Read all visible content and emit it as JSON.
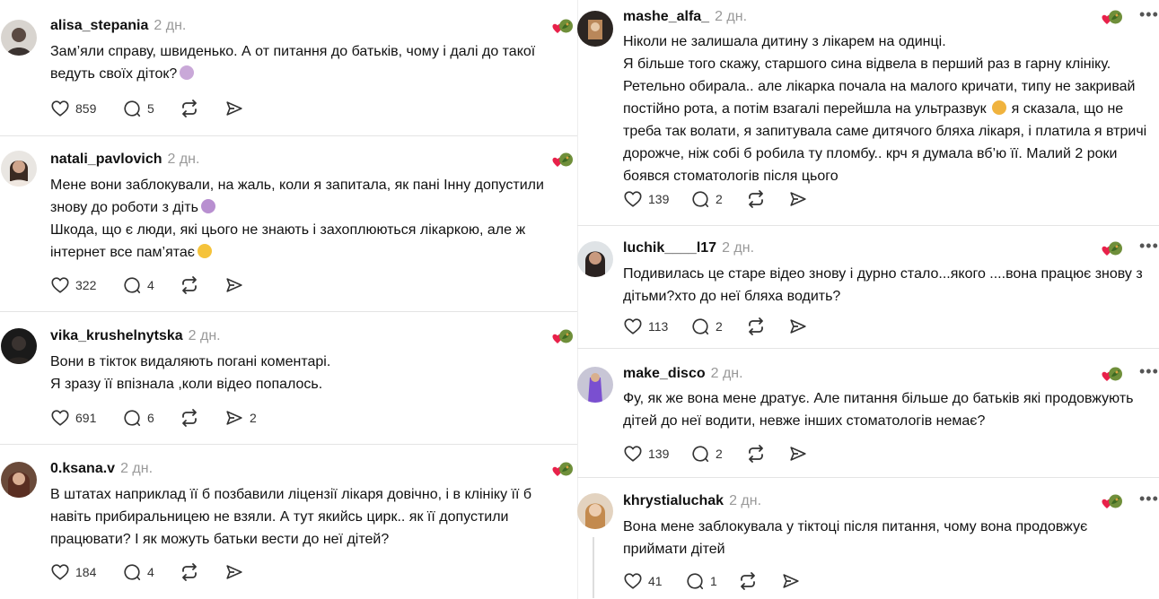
{
  "colors": {
    "separator": "#e4e4e4",
    "username": "#111111",
    "time": "#999999",
    "icon": "#333333",
    "badge_heart": "#e8214a",
    "badge_leaf": "#4a7a2a"
  },
  "left_column": {
    "posts": [
      {
        "username": "alisa_stepania",
        "time": "2 дн.",
        "lines": [
          "Зам’яли справу, швиденько. А от питання до батьків, чому і далі до такої",
          "ведуть своїх діток?"
        ],
        "emoji_icon": "woman-shrugging-emoji",
        "likes": "859",
        "replies": "5",
        "reposts": "",
        "shares": ""
      },
      {
        "username": "natali_pavlovich",
        "time": "2 дн.",
        "lines": [
          "Мене вони заблокували, на жаль, коли я запитала, як пані Інну допустили",
          "знову до роботи з діть",
          "Шкода, що є люди, які цього не знають і захоплюються лікаркою, але ж",
          "інтернет все пам’ятає"
        ],
        "emoji_icon": "face-emoji",
        "likes": "322",
        "replies": "4",
        "reposts": "",
        "shares": ""
      },
      {
        "username": "vika_krushelnytska",
        "time": "2 дн.",
        "lines": [
          "Вони в тікток видаляють погані коментарі.",
          "Я зразу її впізнала ,коли відео попалось."
        ],
        "likes": "691",
        "replies": "6",
        "reposts": "",
        "shares": "2"
      },
      {
        "username": "0.ksana.v",
        "time": "2 дн.",
        "lines": [
          "В штатах наприклад її б позбавили ліцензії лікаря довічно, і в клініку її б",
          "навіть прибиральницею не взяли. А тут якийсь цирк.. як її допустили",
          "працювати? І як можуть батьки вести до неї дітей?"
        ],
        "likes": "184",
        "replies": "4",
        "reposts": "",
        "shares": ""
      }
    ]
  },
  "right_column": {
    "posts": [
      {
        "username": "mashe_alfa_",
        "time": "2 дн.",
        "lines": [
          "Ніколи не залишала дитину з лікарем на одинці.",
          "Я більше того скажу, старшого сина відвела в перший раз в гарну клініку.",
          "Ретельно обирала.. але лікарка почала на малого кричати, типу не закривай",
          "постійно рота, а потім взагалі перейшла на ультразвук",
          "треба так волати, я запитувала саме дитячого бляха лікаря, і платила я втричі",
          "дорожче, ніж собі б робила ту пломбу.. крч я думала вб’ю її. Малий 2 роки",
          "боявся стоматологів після цього"
        ],
        "line4_tail": "я сказала, що не",
        "likes": "139",
        "replies": "2",
        "reposts": "",
        "shares": ""
      },
      {
        "username": "luchik____l17",
        "time": "2 дн.",
        "lines": [
          "Подивилась це старе відео знову і дурно стало...якого ....вона працює знову з",
          "дітьми?хто до неї бляха водить?"
        ],
        "likes": "113",
        "replies": "2",
        "reposts": "",
        "shares": ""
      },
      {
        "username": "make_disco",
        "time": "2 дн.",
        "lines": [
          "Фу, як же вона мене дратує. Але питання більше до батьків які продовжують",
          "дітей до неї водити, невже інших стоматологів немає?"
        ],
        "likes": "139",
        "replies": "2",
        "reposts": "",
        "shares": ""
      },
      {
        "username": "khrystialuchak",
        "time": "2 дн.",
        "lines": [
          "Вона мене заблокувала у тіктоці після питання, чому вона продовжує",
          "приймати дітей"
        ],
        "likes": "41",
        "replies": "1",
        "reposts": "",
        "shares": ""
      }
    ]
  }
}
